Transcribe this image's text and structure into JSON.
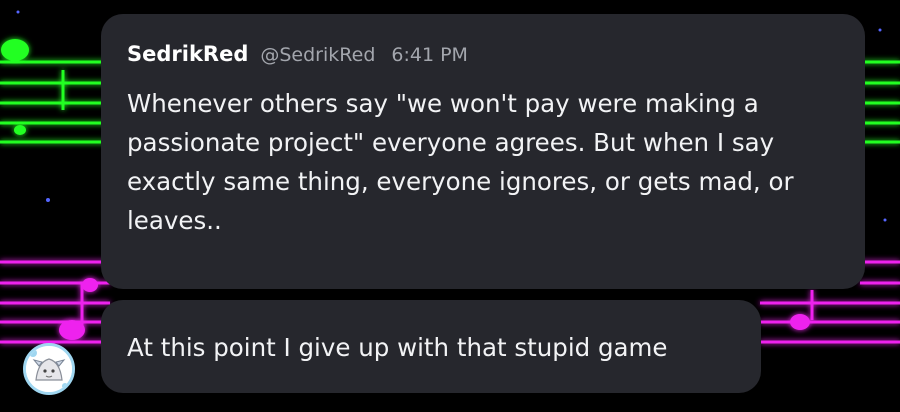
{
  "message_main": {
    "username": "SedrikRed",
    "handle": "@SedrikRed",
    "time": "6:41 PM",
    "text": "Whenever others say \"we won't pay were making a passionate project\" everyone agrees. But when I say exactly same thing, everyone ignores, or gets mad, or leaves.."
  },
  "message_followup": {
    "text": "At this point I give up with that stupid game"
  },
  "colors": {
    "bubble": "#26272d",
    "neon_green": "#22ff22",
    "neon_magenta": "#ee22ee",
    "handle_gray": "#a3a6ad"
  },
  "icons": {
    "avatar": "user-avatar-icon",
    "background": "neon-music-staff-decoration"
  }
}
